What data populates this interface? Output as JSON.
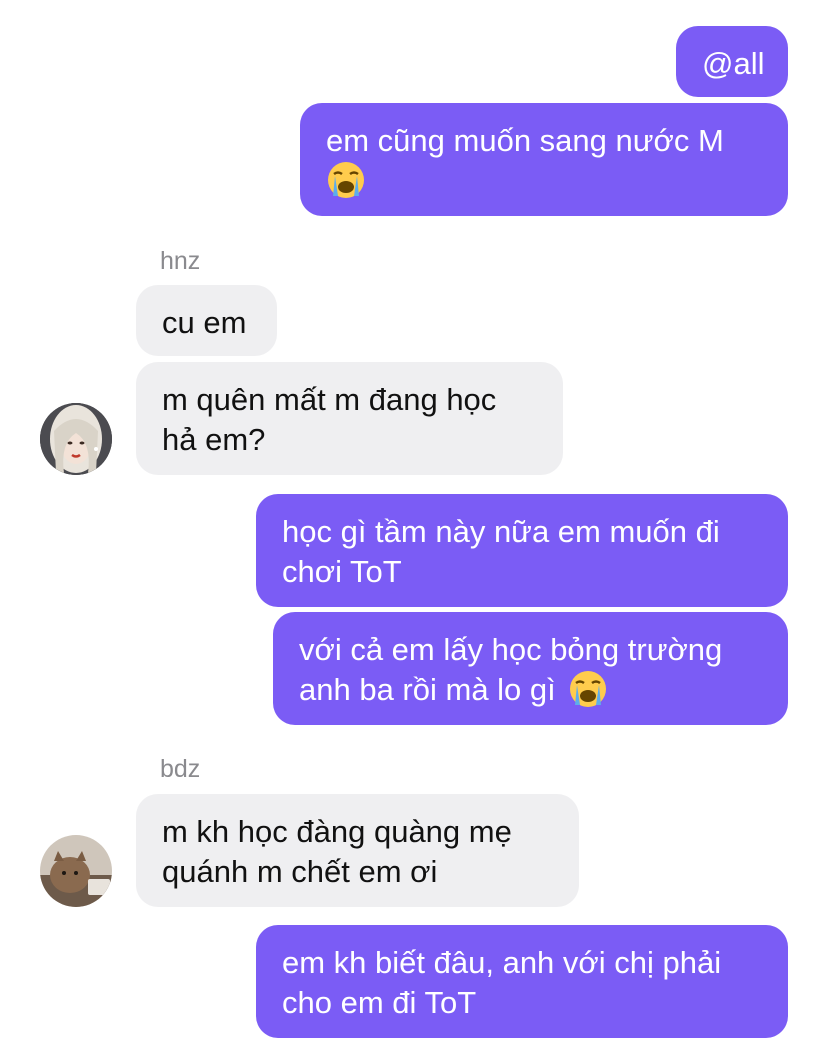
{
  "messages": [
    {
      "sender": "me",
      "lines": [
        "@all"
      ]
    },
    {
      "sender": "me",
      "lines": [
        "em cũng muốn sang nước M",
        ""
      ],
      "emoji": "loudly-crying-face"
    },
    {
      "sender_label": "hnz",
      "lines": [
        "cu em"
      ]
    },
    {
      "sender_label": "hnz",
      "lines": [
        "m quên mất m đang học",
        "hả em?"
      ]
    },
    {
      "sender": "me",
      "lines": [
        "học gì tầm này nữa em muốn đi",
        "chơi ToT"
      ]
    },
    {
      "sender": "me",
      "lines": [
        "với cả em lấy học bỏng trường",
        "anh ba rồi mà lo gì"
      ],
      "emoji": "loudly-crying-face"
    },
    {
      "sender_label": "bdz",
      "lines": [
        "m kh học đàng quàng mẹ",
        "quánh m chết em ơi"
      ]
    },
    {
      "sender": "me",
      "lines": [
        "em kh biết đâu, anh với chị phải",
        "cho em đi ToT"
      ]
    }
  ],
  "senders": {
    "hnz": "hnz",
    "bdz": "bdz"
  },
  "colors": {
    "outgoing": "#7B5CF5",
    "incoming": "#EFEFF1",
    "sender_label": "#8A8A8E"
  }
}
